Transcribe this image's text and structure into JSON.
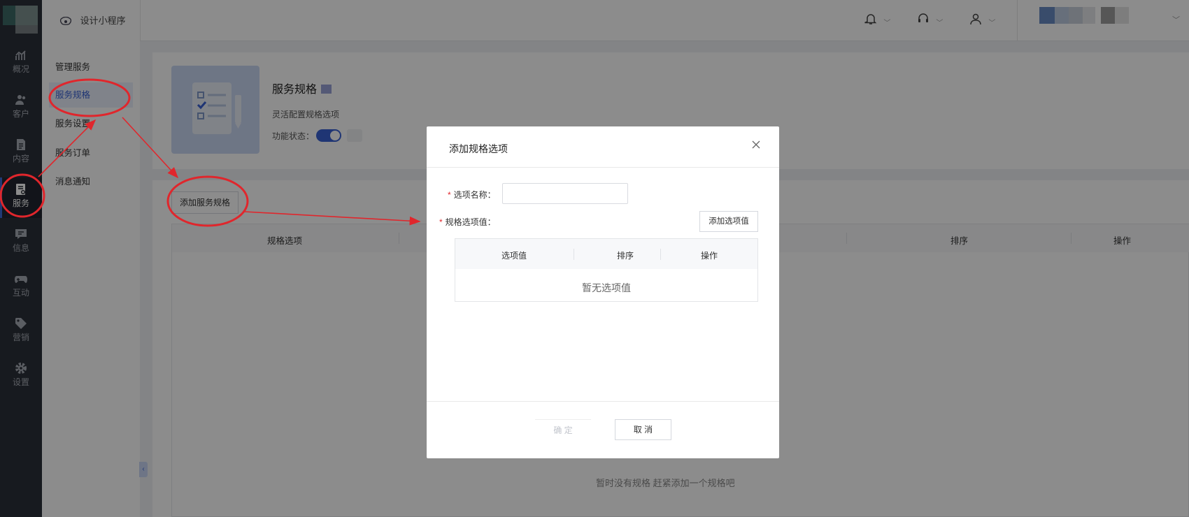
{
  "sidebar": {
    "items": [
      {
        "label": "概况",
        "icon": "chart-icon"
      },
      {
        "label": "客户",
        "icon": "users-icon"
      },
      {
        "label": "内容",
        "icon": "document-icon"
      },
      {
        "label": "服务",
        "icon": "service-icon",
        "active": true
      },
      {
        "label": "信息",
        "icon": "message-icon"
      },
      {
        "label": "互动",
        "icon": "gamepad-icon"
      },
      {
        "label": "营销",
        "icon": "tag-icon"
      },
      {
        "label": "设置",
        "icon": "gear-icon"
      }
    ]
  },
  "header": {
    "app_title": "设计小程序",
    "icons": [
      "bell-icon",
      "headset-icon",
      "user-icon"
    ]
  },
  "subnav": {
    "items": [
      {
        "label": "管理服务"
      },
      {
        "label": "服务规格",
        "active": true
      },
      {
        "label": "服务设置"
      },
      {
        "label": "服务订单"
      },
      {
        "label": "消息通知"
      }
    ]
  },
  "feature": {
    "title": "服务规格",
    "subtitle": "灵活配置规格选项",
    "status_label": "功能状态：",
    "status_on": true
  },
  "main": {
    "add_button": "添加服务规格",
    "columns": [
      "规格选项",
      "排序",
      "操作"
    ],
    "empty_text": "暂时没有规格 赶紧添加一个规格吧"
  },
  "modal": {
    "title": "添加规格选项",
    "name_label": "选项名称：",
    "name_value": "",
    "values_label": "规格选项值：",
    "add_value_button": "添加选项值",
    "inner_columns": [
      "选项值",
      "排序",
      "操作"
    ],
    "inner_empty": "暂无选项值",
    "ok_button": "确 定",
    "cancel_button": "取 消"
  },
  "colors": {
    "accent": "#3a62d3",
    "sidebar_bg": "#2b303a",
    "annotation": "#e0262c"
  }
}
